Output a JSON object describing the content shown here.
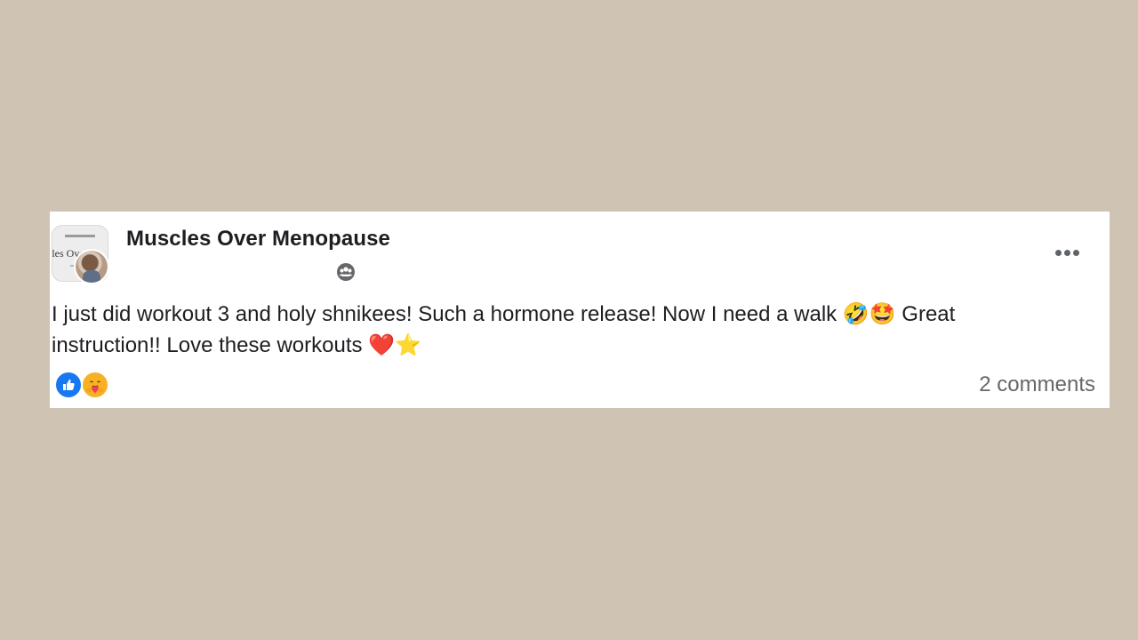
{
  "post": {
    "group_name": "Muscles Over Menopause",
    "text_line1": "I just did workout 3 and holy shnikees! Such a hormone release! Now I need a walk ",
    "emoji_laugh": "🤣",
    "emoji_star_eyes": "🤩",
    "text_line1_end": " Great",
    "text_line2": "instruction!! Love these workouts ",
    "emoji_heart": "❤️",
    "emoji_star": "⭐",
    "comments_label": "2 comments"
  },
  "reactions": {
    "types": [
      "like",
      "care"
    ]
  },
  "icons": {
    "privacy": "group-members-icon",
    "more": "more-options-icon"
  },
  "colors": {
    "background": "#cfc3b4",
    "card": "#ffffff",
    "like_blue": "#1877f2",
    "care_yellow": "#f7b125",
    "meta_gray": "#65676b"
  }
}
